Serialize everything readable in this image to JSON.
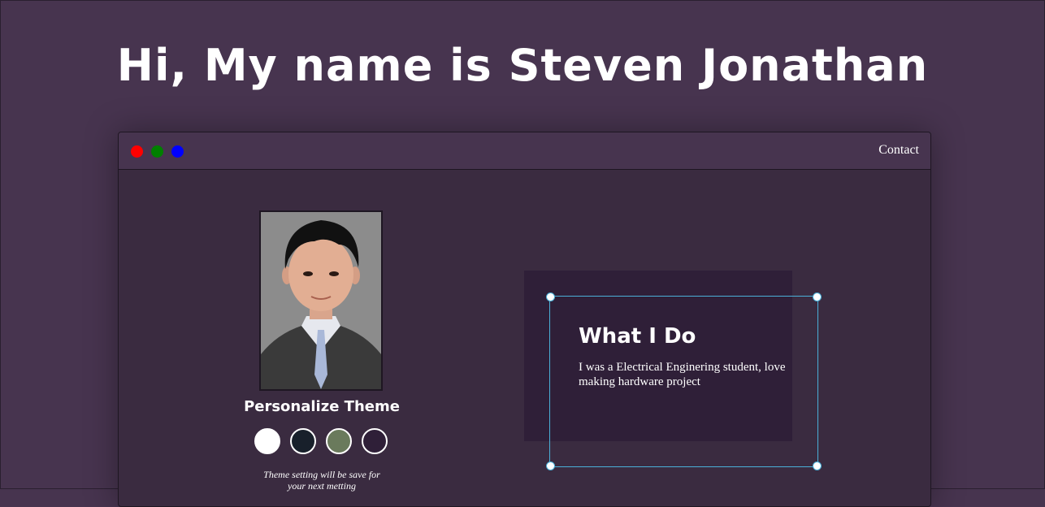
{
  "header": {
    "title": "Hi, My name is Steven Jonathan"
  },
  "window": {
    "dots": [
      {
        "name": "red",
        "color": "#ff0000"
      },
      {
        "name": "green",
        "color": "#008000"
      },
      {
        "name": "blue",
        "color": "#0000ff"
      }
    ],
    "nav": {
      "contact_label": "Contact"
    }
  },
  "profile": {
    "photo_alt": "Portrait photo"
  },
  "theme": {
    "title": "Personalize Theme",
    "swatches": [
      {
        "name": "white",
        "color": "#ffffff"
      },
      {
        "name": "navy",
        "color": "#18202b"
      },
      {
        "name": "sage",
        "color": "#6a7a5c"
      },
      {
        "name": "plum",
        "color": "#2f1f38"
      }
    ],
    "note": "Theme setting will be save for your next metting"
  },
  "card": {
    "title": "What I Do",
    "text": "I was a Electrical Enginering student, love making hardware project"
  },
  "colors": {
    "background": "#47344f",
    "window": "#3a2b40",
    "card": "#2f1f38",
    "selection": "#4ab0d8"
  }
}
